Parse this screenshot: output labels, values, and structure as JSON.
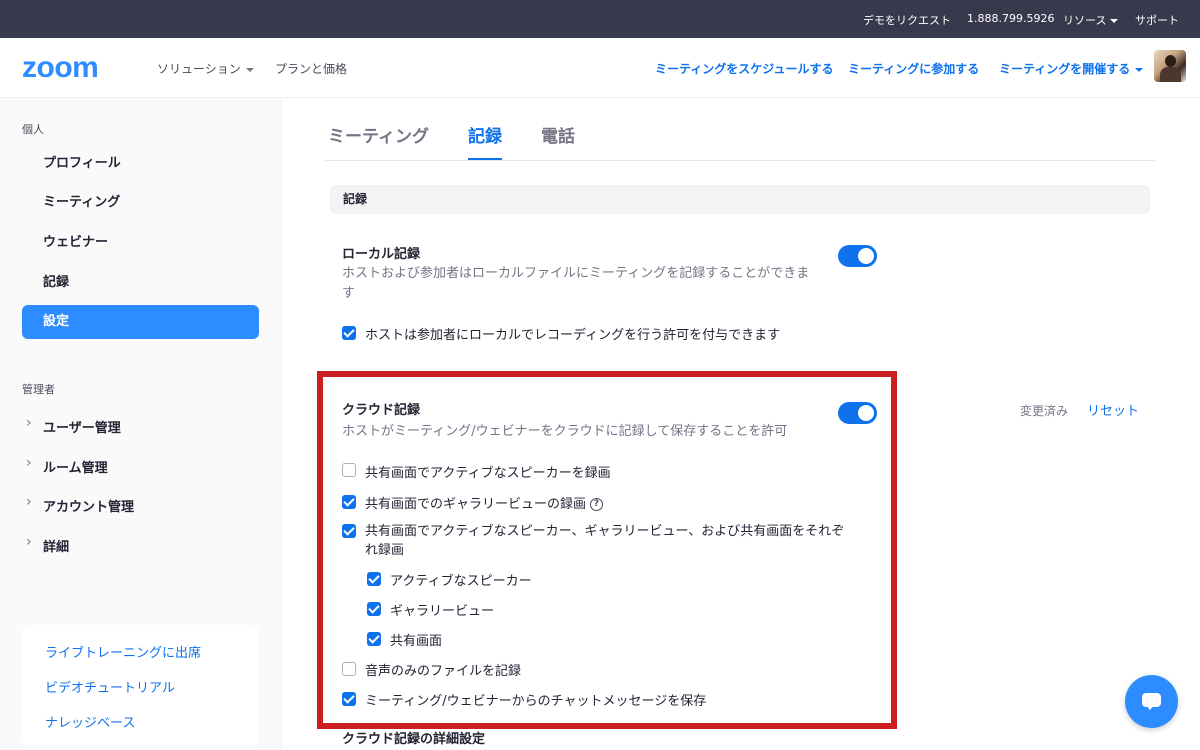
{
  "topbar": {
    "demo": "デモをリクエスト",
    "phone": "1.888.799.5926",
    "resources": "リソース",
    "support": "サポート"
  },
  "header": {
    "logo": "zoom",
    "solutions": "ソリューション",
    "plans": "プランと価格",
    "schedule": "ミーティングをスケジュールする",
    "join": "ミーティングに参加する",
    "host": "ミーティングを開催する"
  },
  "sidebar": {
    "personal_label": "個人",
    "items": [
      "プロフィール",
      "ミーティング",
      "ウェビナー",
      "記録",
      "設定"
    ],
    "active_item": "設定",
    "admin_label": "管理者",
    "admin_items": [
      "ユーザー管理",
      "ルーム管理",
      "アカウント管理",
      "詳細"
    ],
    "help_links": [
      "ライブトレーニングに出席",
      "ビデオチュートリアル",
      "ナレッジベース"
    ]
  },
  "tabs": [
    "ミーティング",
    "記録",
    "電話"
  ],
  "active_tab": "記録",
  "section_title": "記録",
  "local_recording": {
    "title": "ローカル記録",
    "description": "ホストおよび参加者はローカルファイルにミーティングを記録することができます",
    "enabled": true,
    "option_label": "ホストは参加者にローカルでレコーディングを行う許可を付与できます",
    "option_checked": true
  },
  "cloud_recording": {
    "title": "クラウド記録",
    "description": "ホストがミーティング/ウェビナーをクラウドに記録して保存することを許可",
    "enabled": true,
    "status": "変更済み",
    "reset": "リセット",
    "options": [
      {
        "label": "共有画面でアクティブなスピーカーを録画",
        "checked": false
      },
      {
        "label": "共有画面でのギャラリービューの録画",
        "checked": true
      },
      {
        "label": "共有画面でアクティブなスピーカー、ギャラリービュー、および共有画面をそれぞれ録画",
        "checked": true
      },
      {
        "label": "アクティブなスピーカー",
        "checked": true
      },
      {
        "label": "ギャラリービュー",
        "checked": true
      },
      {
        "label": "共有画面",
        "checked": true
      },
      {
        "label": "音声のみのファイルを記録",
        "checked": false
      },
      {
        "label": "ミーティング/ウェビナーからのチャットメッセージを保存",
        "checked": true
      }
    ],
    "help_glyph": "?"
  },
  "advanced_title": "クラウド記録の詳細設定",
  "colors": {
    "brand": "#2d8cff",
    "link": "#0e72ed",
    "highlight_frame": "#cc1f1f",
    "topbar": "#39394d"
  }
}
